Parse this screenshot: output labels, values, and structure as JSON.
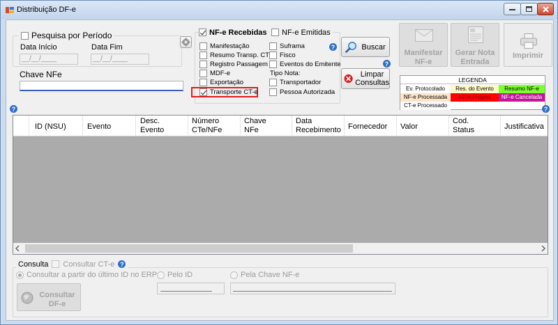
{
  "window": {
    "title": "Distribuição DF-e"
  },
  "periodo": {
    "checkbox_label": "Pesquisa por Período",
    "data_inicio_label": "Data Início",
    "data_fim_label": "Data Fim",
    "data_inicio_value": "__/__/____",
    "data_fim_value": "__/__/____"
  },
  "chave": {
    "label": "Chave NFe",
    "value": ""
  },
  "tipos": {
    "recebidas_label": "NF-e Recebidas",
    "emitidas_label": "NF-e Emitidas",
    "col1": [
      "Manifestação",
      "Resumo Transp. CT-e",
      "Registro Passagem",
      "MDF-e",
      "Exportação",
      "Transporte CT-e"
    ],
    "col2": [
      "Suframa",
      "Fisco",
      "Eventos do Emitente"
    ],
    "tipo_nota_label": "Tipo Nota:",
    "col2b": [
      "Transportador",
      "Pessoa Autorizada"
    ]
  },
  "buttons": {
    "buscar": "Buscar",
    "limpar_line1": "Limpar",
    "limpar_line2": "Consultas",
    "manifestar_line1": "Manifestar",
    "manifestar_line2": "NF-e",
    "gerar_line1": "Gerar Nota",
    "gerar_line2": "Entrada",
    "imprimir": "Imprimir",
    "consultar_line1": "Consultar",
    "consultar_line2": "DF-e"
  },
  "legenda": {
    "title": "LEGENDA",
    "items": [
      {
        "label": "Ev. Protocolado",
        "color": "#ffffff"
      },
      {
        "label": "Res. do Evento",
        "color": "#fff8c8"
      },
      {
        "label": "Resumo NF-e",
        "color": "#7cff2e"
      },
      {
        "label": "NF-e Processada",
        "color": "#fde4c8"
      },
      {
        "label": "NF-e Própria",
        "color": "#ff0000"
      },
      {
        "label": "NF-e Cancelada",
        "color": "#c0189a"
      },
      {
        "label": "CT-e Processado",
        "color": "#ffffff"
      }
    ]
  },
  "grid": {
    "columns": [
      "ID (NSU)",
      "Evento",
      "Desc.\nEvento",
      "Número\nCTe/NFe",
      "Chave\nNFe",
      "Data\nRecebimento",
      "Fornecedor",
      "Valor",
      "Cod.\nStatus",
      "Justificativa"
    ]
  },
  "consulta": {
    "group_label": "Consulta",
    "ct_label": "Consultar CT-e",
    "radio1": "Consultar a partir do último ID no ERP",
    "radio2": "Pelo ID",
    "radio3": "Pela Chave NF-e"
  }
}
